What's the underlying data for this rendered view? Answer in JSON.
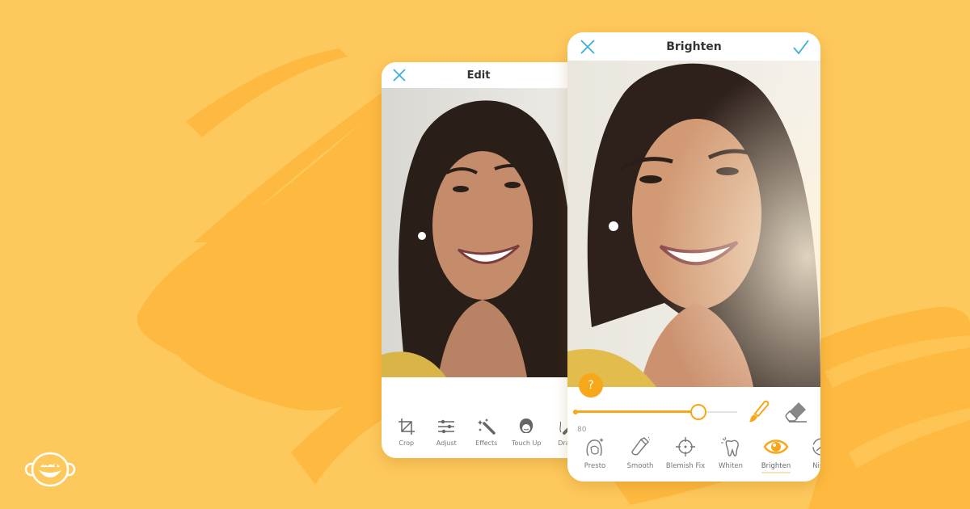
{
  "colors": {
    "background": "#fec95c",
    "brushstroke": "#feba40",
    "accent": "#f6a81a",
    "close_icon": "#3db0d6",
    "confirm_icon": "#3db0d6"
  },
  "brand": {
    "logo_icon": "monkey-face-logo"
  },
  "edit_screen": {
    "title": "Edit",
    "close_icon": "close-x",
    "photo_alt": "Smiling woman portrait (original)",
    "tools": [
      {
        "label": "Crop",
        "icon": "crop"
      },
      {
        "label": "Adjust",
        "icon": "sliders"
      },
      {
        "label": "Effects",
        "icon": "magic-wand"
      },
      {
        "label": "Touch Up",
        "icon": "face"
      },
      {
        "label": "Draw",
        "icon": "pencil"
      }
    ]
  },
  "brighten_screen": {
    "title": "Brighten",
    "close_icon": "close-x",
    "confirm_icon": "checkmark",
    "photo_alt": "Smiling woman portrait (brightened)",
    "help_label": "?",
    "slider": {
      "value": 80,
      "value_label": "80",
      "fill_fraction": 0.8
    },
    "brush_icon": "paintbrush",
    "eraser_icon": "eraser",
    "tools": [
      {
        "label": "Presto",
        "icon": "presto-face",
        "active": false
      },
      {
        "label": "Smooth",
        "icon": "smooth-brush",
        "active": false
      },
      {
        "label": "Blemish Fix",
        "icon": "crosshair",
        "active": false
      },
      {
        "label": "Whiten",
        "icon": "tooth",
        "active": false
      },
      {
        "label": "Brighten",
        "icon": "eye",
        "active": true
      },
      {
        "label": "Ninja",
        "icon": "ninja",
        "active": false
      }
    ]
  }
}
